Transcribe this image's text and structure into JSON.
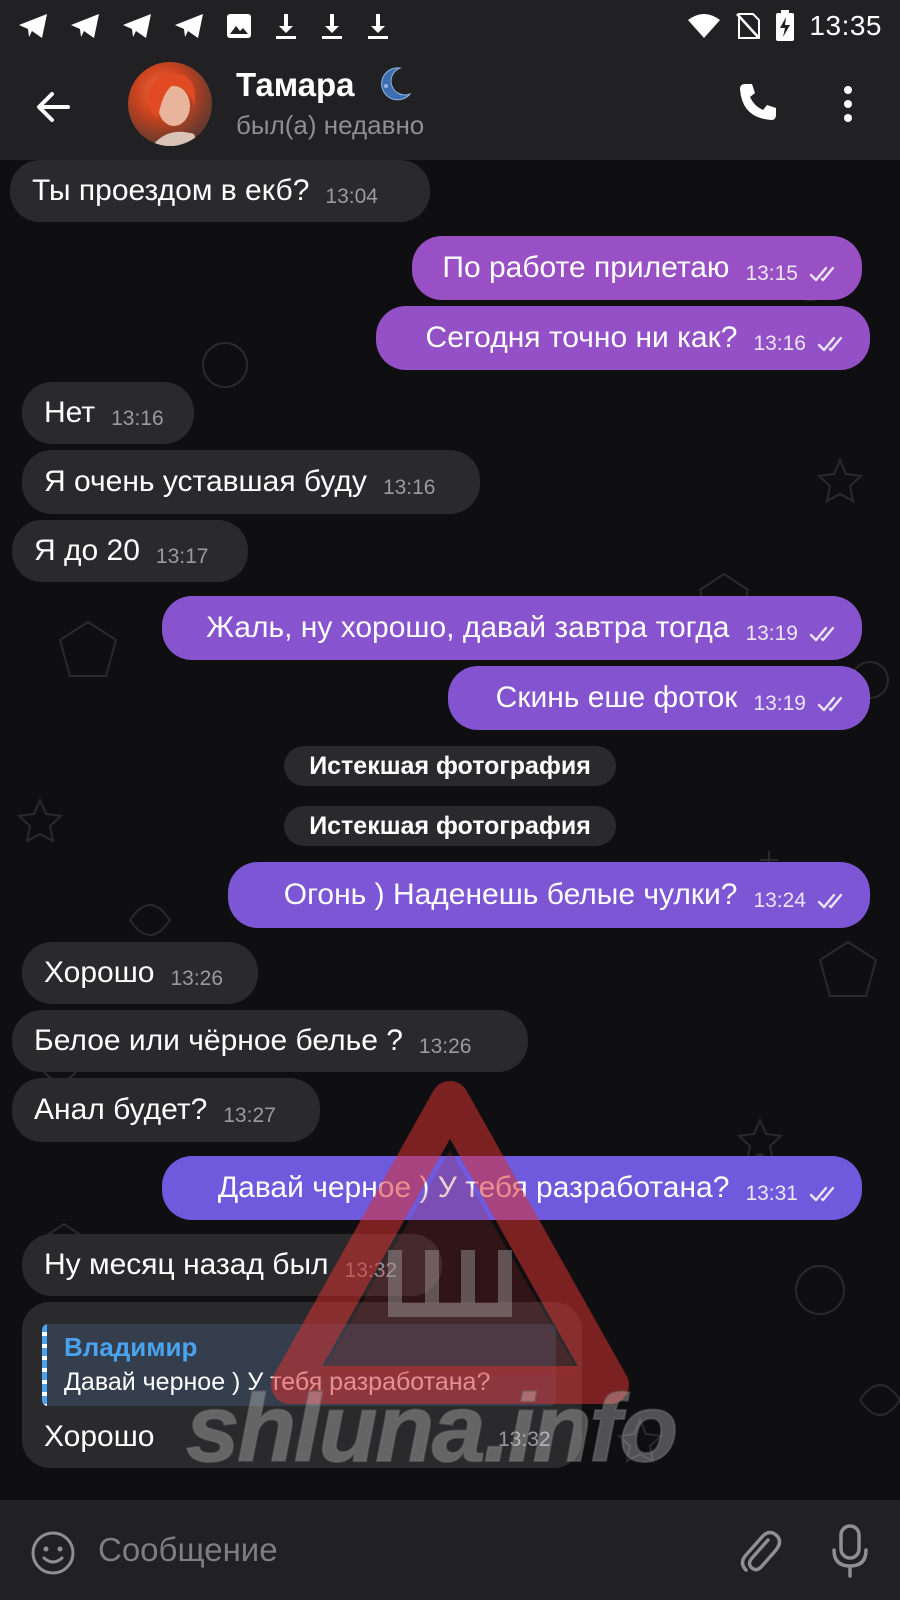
{
  "status_bar": {
    "time": "13:35",
    "left_icons": [
      "telegram-icon",
      "telegram-icon",
      "telegram-icon",
      "telegram-icon",
      "image-icon",
      "download-icon",
      "download-icon",
      "download-icon"
    ],
    "right_icons": [
      "wifi-icon",
      "no-signal-icon",
      "battery-charging-icon"
    ]
  },
  "header": {
    "name": "Тамара",
    "status": "был(а) недавно",
    "icons": [
      "back-arrow-icon",
      "avatar",
      "moon-emoji-icon",
      "phone-icon",
      "more-vertical-icon"
    ]
  },
  "messages": [
    {
      "dir": "in",
      "text": "Ты проездом в екб?",
      "time": "13:04"
    },
    {
      "dir": "out",
      "text": "По работе прилетаю",
      "time": "13:15",
      "read": true
    },
    {
      "dir": "out",
      "text": "Сегодня точно ни как?",
      "time": "13:16",
      "read": true
    },
    {
      "dir": "in",
      "text": "Нет",
      "time": "13:16"
    },
    {
      "dir": "in",
      "text": "Я очень уставшая буду",
      "time": "13:16"
    },
    {
      "dir": "in",
      "text": "Я до 20",
      "time": "13:17"
    },
    {
      "dir": "out",
      "text": "Жаль, ну хорошо, давай завтра тогда",
      "time": "13:19",
      "read": true
    },
    {
      "dir": "out",
      "text": "Скинь еше фоток",
      "time": "13:19",
      "read": true
    },
    {
      "dir": "service",
      "text": "Истекшая фотография"
    },
    {
      "dir": "service",
      "text": "Истекшая фотография"
    },
    {
      "dir": "out",
      "text": "Огонь ) Наденешь белые чулки?",
      "time": "13:24",
      "read": true
    },
    {
      "dir": "in",
      "text": "Хорошо",
      "time": "13:26"
    },
    {
      "dir": "in",
      "text": "Белое или чёрное белье ?",
      "time": "13:26"
    },
    {
      "dir": "in",
      "text": "Анал будет?",
      "time": "13:27"
    },
    {
      "dir": "out",
      "text": "Давай черное ) У тебя разработана?",
      "time": "13:31",
      "read": true
    },
    {
      "dir": "in",
      "text": "Ну месяц назад был",
      "time": "13:32"
    }
  ],
  "reply_message": {
    "quote_author": "Владимир",
    "quote_text": "Давай черное ) У тебя разработана?",
    "text": "Хорошо",
    "time": "13:32"
  },
  "watermark": {
    "text": "shluna.info"
  },
  "composer": {
    "placeholder": "Сообщение",
    "icons": [
      "emoji-icon",
      "attach-icon",
      "microphone-icon"
    ]
  },
  "colors": {
    "outgoing_gradient_top": "#9b4fc2",
    "outgoing_gradient_bottom": "#6a5ae0",
    "incoming": "#2a2a2c",
    "accent_blue": "#4aa3ef"
  }
}
